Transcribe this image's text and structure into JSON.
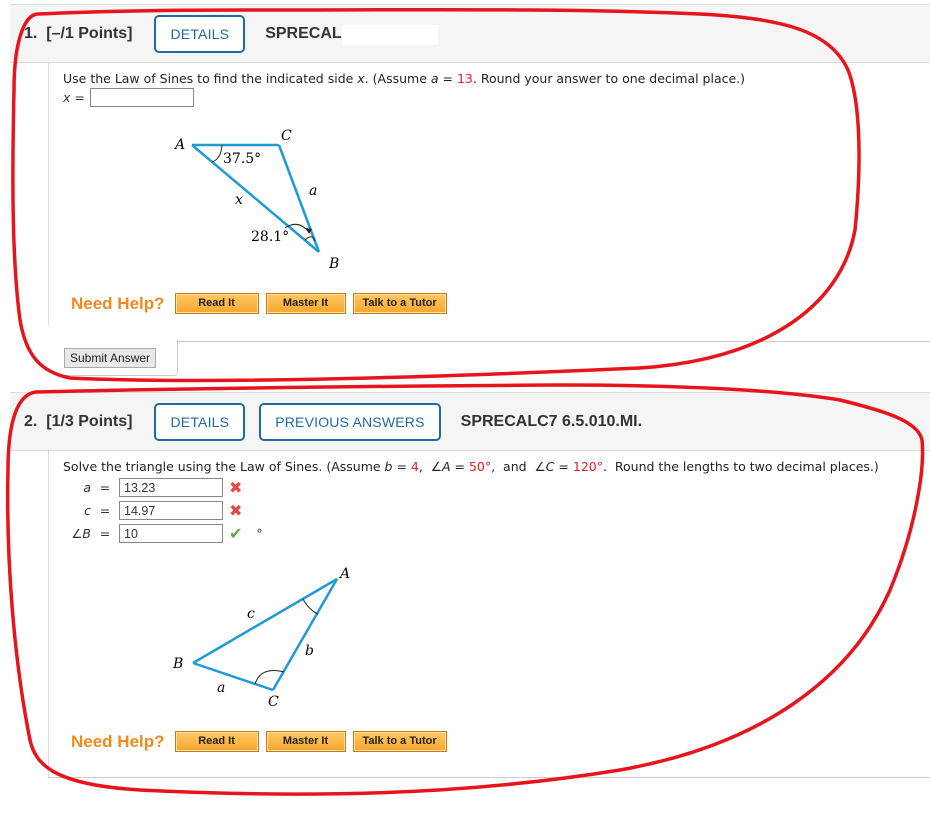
{
  "question1": {
    "number_label": "1.",
    "points_label": "[–/1 Points]",
    "details_button": "DETAILS",
    "code": "SPRECALC",
    "prompt_prefix": "Use the Law of Sines to find the indicated side ",
    "prompt_var": "x",
    "prompt_mid": ". (Assume ",
    "prompt_a_var": "a",
    "prompt_eq": " = ",
    "prompt_a_value": "13",
    "prompt_suffix": ". Round your answer to one decimal place.)",
    "answer_label": "x =",
    "answer_value": "",
    "figure": {
      "vertex_A": "A",
      "vertex_B": "B",
      "vertex_C": "C",
      "angle_A": "37.5°",
      "angle_B": "28.1°",
      "side_x": "x",
      "side_a": "a"
    },
    "need_help_label": "Need Help?",
    "help_buttons": [
      "Read It",
      "Master It",
      "Talk to a Tutor"
    ],
    "submit_label": "Submit Answer"
  },
  "question2": {
    "number_label": "2.",
    "points_label": "[1/3 Points]",
    "details_button": "DETAILS",
    "previous_answers_button": "PREVIOUS ANSWERS",
    "code": "SPRECALC7 6.5.010.MI.",
    "prompt_prefix": "Solve the triangle using the Law of Sines. (Assume ",
    "b_var": "b",
    "b_value": "4",
    "angleA_var": "∠A",
    "angleA_value": "50°",
    "angleC_var": "∠C",
    "angleC_value": "120°",
    "prompt_and": ",  and  ",
    "prompt_suffix": ".  Round the lengths to two decimal places.)",
    "answers": [
      {
        "label": "a",
        "eq": "=",
        "value": "13.23",
        "status": "incorrect",
        "status_icon": "✖",
        "unit": ""
      },
      {
        "label": "c",
        "eq": "=",
        "value": "14.97",
        "status": "incorrect",
        "status_icon": "✖",
        "unit": ""
      },
      {
        "label": "∠B",
        "eq": "=",
        "value": "10",
        "status": "correct",
        "status_icon": "✔",
        "unit": "°"
      }
    ],
    "figure": {
      "vertex_A": "A",
      "vertex_B": "B",
      "vertex_C": "C",
      "side_a": "a",
      "side_b": "b",
      "side_c": "c"
    },
    "need_help_label": "Need Help?",
    "help_buttons": [
      "Read It",
      "Master It",
      "Talk to a Tutor"
    ]
  },
  "colors": {
    "accent_blue": "#1f6aa0",
    "given_value_red": "#e0201f",
    "help_orange": "#f08a1d",
    "incorrect_red": "#e8474a",
    "correct_green": "#5aa84a",
    "triangle_blue": "#1f9ad6",
    "annotation_red": "#e8141c"
  }
}
